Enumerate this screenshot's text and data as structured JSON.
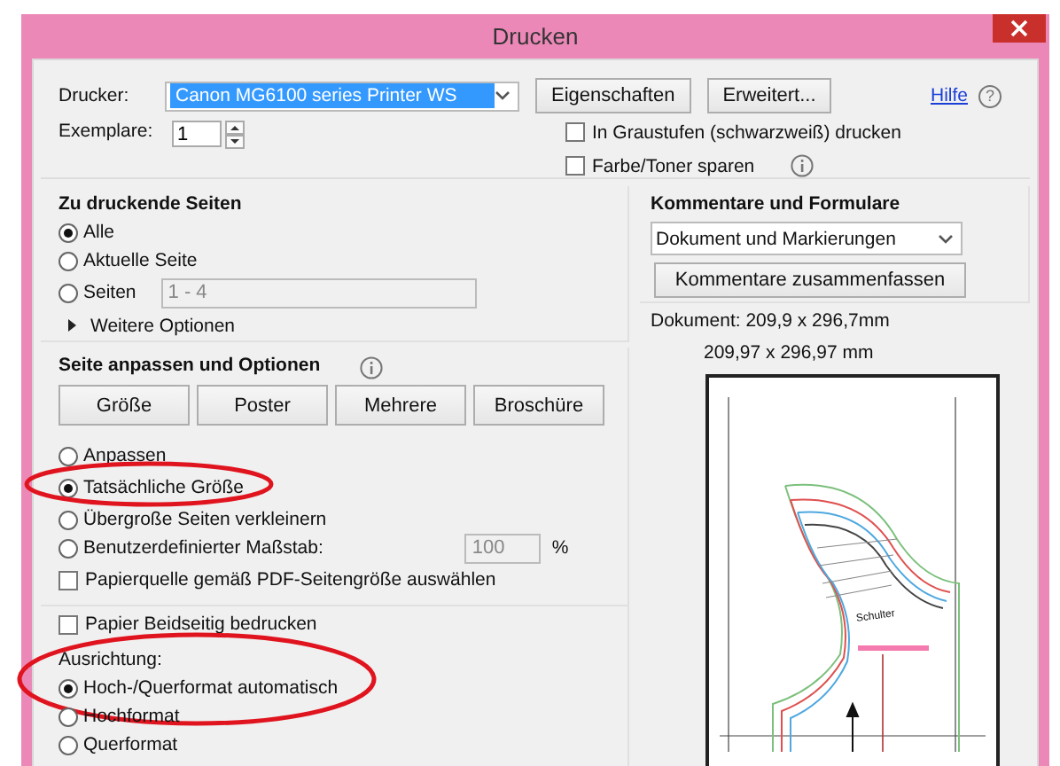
{
  "window": {
    "title": "Drucken"
  },
  "printer": {
    "label": "Drucker:",
    "value": "Canon MG6100 series Printer WS"
  },
  "top_buttons": [
    "Eigenschaften",
    "Erweitert..."
  ],
  "help": {
    "link": "Hilfe",
    "icon": "?"
  },
  "copies": {
    "label": "Exemplare:",
    "value": "1"
  },
  "options": [
    {
      "label": "In Graustufen (schwarzweiß) drucken",
      "checked": false,
      "info": false
    },
    {
      "label": "Farbe/Toner sparen",
      "checked": false,
      "info": true
    }
  ],
  "pages_section": {
    "title": "Zu druckende Seiten",
    "choices": [
      {
        "label": "Alle",
        "selected": true
      },
      {
        "label": "Aktuelle Seite",
        "selected": false
      },
      {
        "label": "Seiten",
        "selected": false,
        "field": "1 - 4"
      }
    ],
    "more": {
      "label": "Weitere Optionen",
      "expanded": false
    }
  },
  "fit_section": {
    "title": "Seite anpassen und Optionen",
    "buttons": [
      "Größe",
      "Poster",
      "Mehrere",
      "Broschüre"
    ],
    "choices": [
      {
        "label": "Anpassen",
        "selected": false,
        "highlighted": false
      },
      {
        "label": "Tatsächliche Größe",
        "selected": true,
        "highlighted": true
      },
      {
        "label": "Übergroße Seiten verkleinern",
        "selected": false,
        "highlighted": false
      },
      {
        "label": "Benutzerdefinierter Maßstab:",
        "selected": false,
        "highlighted": false,
        "field": "100",
        "unit": "%"
      }
    ],
    "paper_source": {
      "label": "Papierquelle gemäß PDF-Seitengröße auswählen",
      "checked": false
    }
  },
  "duplex": {
    "label": "Papier Beidseitig bedrucken",
    "checked": false
  },
  "orientation": {
    "label": "Ausrichtung:",
    "highlighted": true,
    "choices": [
      {
        "label": "Hoch-/Querformat automatisch",
        "selected": true
      },
      {
        "label": "Hochformat",
        "selected": false
      },
      {
        "label": "Querformat",
        "selected": false
      }
    ]
  },
  "comments": {
    "title": "Kommentare und Formulare",
    "value": "Dokument und Markierungen",
    "button": "Kommentare zusammenfassen"
  },
  "preview": {
    "document_size": "Dokument: 209,9 x 296,7mm",
    "page_size": "209,97 x 296,97 mm",
    "label": "Schulter"
  }
}
